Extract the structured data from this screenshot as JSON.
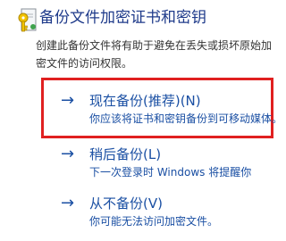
{
  "dialog": {
    "title": "备份文件加密证书和密钥",
    "description": "创建此备份文件将有助于避免在丢失或损坏原始加密文件的访问权限。",
    "icon": "certificate-key-icon"
  },
  "options": [
    {
      "arrow": "→",
      "title": "现在备份(推荐)(N)",
      "subtitle": "你应该将证书和密钥备份到可移动媒体。"
    },
    {
      "arrow": "→",
      "title": "稍后备份(L)",
      "subtitle": "下一次登录时 Windows 将提醒你"
    },
    {
      "arrow": "→",
      "title": "从不备份(V)",
      "subtitle": "你可能无法访问加密文件。"
    }
  ],
  "colors": {
    "title": "#1e3a8a",
    "link": "#1a4fa3",
    "highlight": "#e02020"
  }
}
